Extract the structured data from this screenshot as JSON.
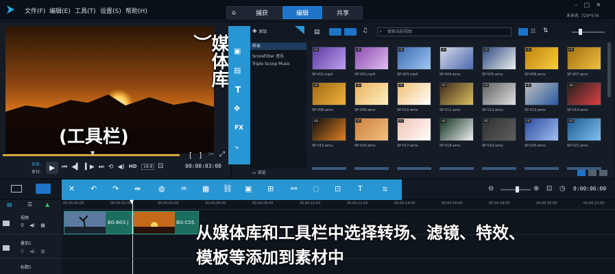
{
  "menu": [
    "文件(F)",
    "编辑(E)",
    "工具(T)",
    "设置(S)",
    "帮助(H)"
  ],
  "tabs": {
    "home": "⌂",
    "capture": "捕获",
    "edit": "编辑",
    "share": "共享"
  },
  "project_info": "未命名, 720*576",
  "overlay": {
    "library": "媒体库",
    "toolbar": "(工具栏)",
    "caption_line1": "从媒体库和工具栏中选择转场、滤镜、特效、",
    "caption_line2": "模板等添加到素材中"
  },
  "player": {
    "mode1": "项目-",
    "mode2": "素材-",
    "time": "00:00:03:00",
    "ratio": "16:9"
  },
  "library": {
    "add_label": "添加",
    "search_placeholder": "搜索当前视图",
    "folders": [
      "样本",
      "ScoreFitter 音乐",
      "Triple Scoop Music"
    ],
    "browse_label": "浏览",
    "items": [
      "SP-V01.mp4",
      "SP-V02.mp4",
      "SP-V03.mp4",
      "SP-V04.wmv",
      "SP-V05.wmv",
      "SP-V06.wmv",
      "SP-V07.wmv",
      "SP-V08.wmv",
      "SP-V09.wmv",
      "SP-V10.wmv",
      "SP-V11.wmv",
      "SP-V12.wmv",
      "SP-V13.wmv",
      "SP-V14.wmv",
      "SP-V15.wmv",
      "SP-V16.wmv",
      "SP-V17.wmv",
      "SP-V18.wmv",
      "SP-V19.wmv",
      "SP-V20.wmv",
      "SP-V21.wmv"
    ]
  },
  "timeline": {
    "zoom_time": "0:00:06:00",
    "ruler": [
      "00:00:00:00",
      "00:00:02:00",
      "00:00:04:00",
      "00:00:06:00",
      "00:00:08:00",
      "00:00:10:00",
      "00:00:12:00",
      "00:00:14:00",
      "00:00:16:00",
      "00:00:18:00",
      "00:00:20:00",
      "00:00:22:00"
    ],
    "tracks": [
      "视频",
      "叠加1",
      "标题1"
    ],
    "clips": [
      "BG-B03.j",
      "BG-C05."
    ]
  },
  "colors": {
    "accent": "#2796d2",
    "tab_active": "#1d74c9"
  }
}
